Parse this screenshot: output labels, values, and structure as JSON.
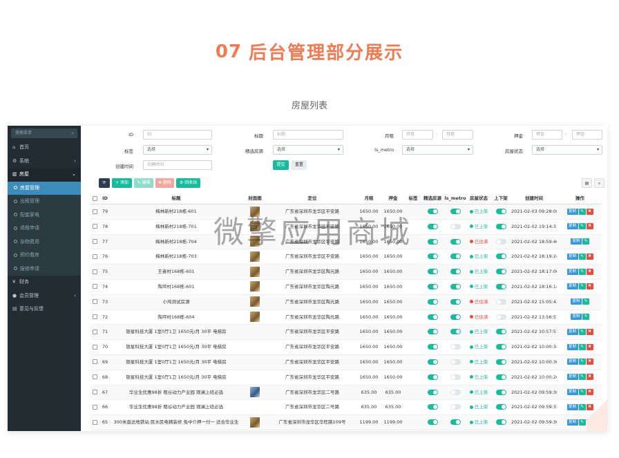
{
  "hero": {
    "number": "07",
    "title": "后台管理部分展示"
  },
  "subtitle": "房屋列表",
  "watermark": "微擎应用商城",
  "sidebar": {
    "search_placeholder": "搜索菜单",
    "items": [
      {
        "label": "首页",
        "icon": "home-icon"
      },
      {
        "label": "系统",
        "icon": "cogs-icon",
        "arrow": "‹"
      },
      {
        "label": "房屋",
        "icon": "bank-icon",
        "arrow": "⌄"
      }
    ],
    "sub_items": [
      {
        "label": "房屋管理",
        "active": true
      },
      {
        "label": "出租管理"
      },
      {
        "label": "配套家电"
      },
      {
        "label": "退租申请"
      },
      {
        "label": "杂物费用"
      },
      {
        "label": "预约看房"
      },
      {
        "label": "报修申请"
      }
    ],
    "items_after": [
      {
        "label": "财务",
        "icon": "yen-icon"
      },
      {
        "label": "会员管理",
        "icon": "user-icon",
        "arrow": "‹"
      },
      {
        "label": "意见与反馈",
        "icon": "book-icon"
      }
    ]
  },
  "filters": {
    "id_label": "ID",
    "id_placeholder": "ID",
    "title_label": "标题",
    "title_placeholder": "标题",
    "rent_label": "月租",
    "rent_placeholder_1": "月租",
    "rent_placeholder_2": "月租",
    "deposit_label": "押金",
    "deposit_placeholder_1": "押金",
    "deposit_placeholder_2": "押金",
    "tag_label": "标签",
    "tag_value": "选择",
    "featured_label": "精选房源",
    "featured_value": "选择",
    "metro_label": "ls_metro",
    "metro_value": "选择",
    "status_label": "房屋状态",
    "status_value": "选择",
    "created_label": "创建时间",
    "created_placeholder": "创建时间",
    "submit": "提交",
    "reset": "重置",
    "dash": "-"
  },
  "toolbar": {
    "refresh": "⟳",
    "add": "+ 添加",
    "edit": "✎ 编辑",
    "delete": "✖ 删除",
    "recycle": "⚙ 回收站"
  },
  "columns": [
    "ID",
    "标题",
    "封面图",
    "定位",
    "月租",
    "押金",
    "标签",
    "精选房源",
    "ls_metro",
    "房屋状态",
    "上下架",
    "创建时间",
    "操作"
  ],
  "actions": {
    "copy": "复制",
    "edit": "✎",
    "delete": "🗑"
  },
  "rows": [
    {
      "id": "79",
      "title": "梅林新村218栋-601",
      "location": "广东省深圳市龙华区平安路",
      "rent": "1650.00",
      "deposit": "1650.00",
      "featured": true,
      "metro": true,
      "status": "已上架",
      "status_on": true,
      "shelf": true,
      "created": "2021-02-03 09:28:08",
      "thumb": "gold",
      "del": true
    },
    {
      "id": "78",
      "title": "梅林新村218栋-701",
      "location": "广东省深圳市龙华区平安路",
      "rent": "1650.00",
      "deposit": "1650.00",
      "featured": true,
      "metro": false,
      "status": "已上架",
      "status_on": true,
      "shelf": true,
      "created": "2021-02-02 19:14:31",
      "thumb": "gold",
      "del": true
    },
    {
      "id": "77",
      "title": "梅林新村218栋-704",
      "location": "广东省深圳市龙华区平安路",
      "rent": "1650.00",
      "deposit": "1650.00",
      "featured": true,
      "metro": true,
      "status": "已住满",
      "status_on": false,
      "shelf": false,
      "created": "2021-02-02 18:59:46",
      "thumb": "gold",
      "del": false
    },
    {
      "id": "76",
      "title": "梅林新村218栋-703",
      "location": "广东省深圳市龙华区平安路",
      "rent": "1650.00",
      "deposit": "1650.00",
      "featured": true,
      "metro": true,
      "status": "已上架",
      "status_on": true,
      "shelf": true,
      "created": "2021-02-02 18:19:24",
      "thumb": "gold",
      "del": true
    },
    {
      "id": "75",
      "title": "王者村168栋-601",
      "location": "广东省深圳市龙华区陶元路",
      "rent": "1650.00",
      "deposit": "1650.00",
      "featured": true,
      "metro": true,
      "status": "已上架",
      "status_on": true,
      "shelf": true,
      "created": "2021-02-02 18:17:00",
      "thumb": "gold",
      "del": true
    },
    {
      "id": "74",
      "title": "陶坪村168栋-601",
      "location": "广东省深圳市龙华区陶元路",
      "rent": "1650.00",
      "deposit": "1650.00",
      "featured": true,
      "metro": true,
      "status": "已上架",
      "status_on": true,
      "shelf": true,
      "created": "2021-02-02 18:16:14",
      "thumb": "gold",
      "del": true
    },
    {
      "id": "73",
      "title": "小鸠测试房源",
      "location": "广东省深圳市龙华区陶元路",
      "rent": "1650.00",
      "deposit": "1650.00",
      "featured": true,
      "metro": true,
      "status": "已住满",
      "status_on": false,
      "shelf": false,
      "created": "2021-02-02 15:05:43",
      "thumb": "gold",
      "del": false
    },
    {
      "id": "72",
      "title": "陶坪村168栋-604",
      "location": "广东省深圳市龙华区陶元路",
      "rent": "1650.00",
      "deposit": "1650.00",
      "featured": true,
      "metro": true,
      "status": "已住满",
      "status_on": false,
      "shelf": false,
      "created": "2021-02-02 13:56:57",
      "thumb": "gold",
      "del": false
    },
    {
      "id": "71",
      "title": "银星科技大厦 1室0厅1卫 1650元/月 30平 电梯房",
      "location": "广东省深圳市龙华区平安路",
      "rent": "1650.00",
      "deposit": "1650.00",
      "featured": true,
      "metro": true,
      "status": "已上架",
      "status_on": true,
      "shelf": true,
      "created": "2021-02-02 10:57:51",
      "thumb": "none",
      "del": true
    },
    {
      "id": "70",
      "title": "银星科技大厦 1室0厅1卫 1650元/月 30平 电梯房",
      "location": "广东省深圳市龙华区平安路",
      "rent": "1650.00",
      "deposit": "1650.00",
      "featured": true,
      "metro": false,
      "status": "已上架",
      "status_on": true,
      "shelf": true,
      "created": "2021-02-02 10:00:34",
      "thumb": "none",
      "del": true
    },
    {
      "id": "69",
      "title": "银星科技大厦 1室0厅1卫 1650元/月 30平 电梯房",
      "location": "广东省深圳市龙华区平安路",
      "rent": "1650.00",
      "deposit": "1650.00",
      "featured": true,
      "metro": false,
      "status": "已上架",
      "status_on": true,
      "shelf": true,
      "created": "2021-02-02 10:00:30",
      "thumb": "none",
      "del": true
    },
    {
      "id": "68",
      "title": "银星科技大厦 1室0厅1卫 1650元/月 30平 电梯房",
      "location": "广东省深圳市龙华区平安路",
      "rent": "1650.00",
      "deposit": "1650.00",
      "featured": true,
      "metro": false,
      "status": "已上架",
      "status_on": true,
      "shelf": true,
      "created": "2021-02-02 10:00:26",
      "thumb": "none",
      "del": true
    },
    {
      "id": "67",
      "title": "华业生优惠98折 租谷动力产业园 观澜上班必选",
      "location": "广东省深圳市龙华区二号路",
      "rent": "635.00",
      "deposit": "635.00",
      "featured": true,
      "metro": false,
      "status": "已上架",
      "status_on": true,
      "shelf": true,
      "created": "2021-02-02 09:59:38",
      "thumb": "blue",
      "del": true
    },
    {
      "id": "66",
      "title": "华业生优惠98折 租谷动力产业园 观澜上班必选",
      "location": "广东省深圳市龙华区二号路",
      "rent": "635.00",
      "deposit": "635.00",
      "featured": true,
      "metro": false,
      "status": "已上架",
      "status_on": true,
      "shelf": true,
      "created": "2021-02-02 09:59:33",
      "thumb": "none",
      "del": true
    },
    {
      "id": "65",
      "title": "300米直达地铁站 民水民电精装修 免中介押一付一 适合华业生",
      "location": "广东省深圳市龙华区华旺路109号",
      "rent": "1199.00",
      "deposit": "1199.00",
      "featured": true,
      "metro": true,
      "status": "已上架",
      "status_on": true,
      "shelf": true,
      "created": "2021-02-02 09:59:30",
      "thumb": "gold",
      "del": true
    }
  ]
}
